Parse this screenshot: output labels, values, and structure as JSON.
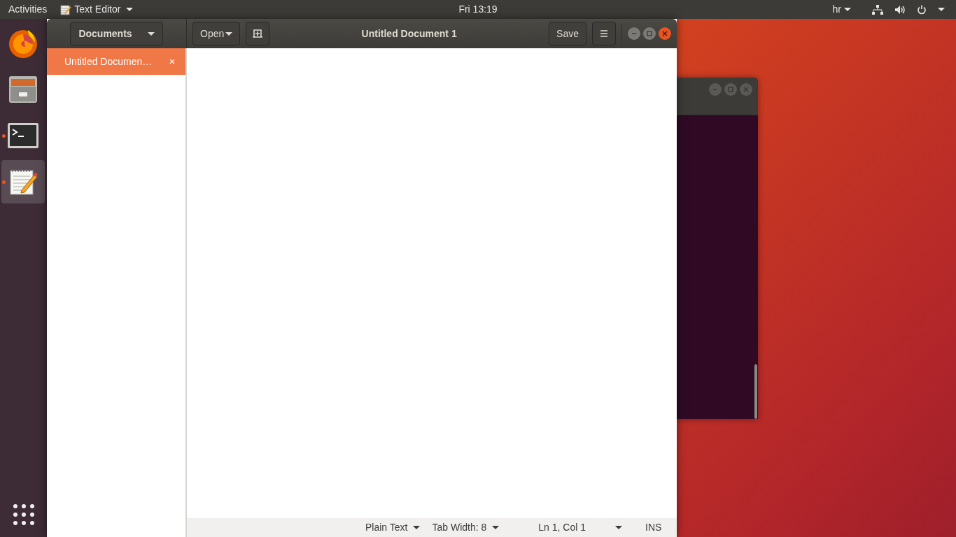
{
  "top_bar": {
    "activities": "Activities",
    "app_menu": "Text Editor",
    "clock": "Fri 13:19",
    "keyboard_layout": "hr"
  },
  "dock": [
    {
      "kind": "browser",
      "running": false,
      "selected": false
    },
    {
      "kind": "files",
      "running": false,
      "selected": false
    },
    {
      "kind": "terminal",
      "running": true,
      "selected": false
    },
    {
      "kind": "editor",
      "running": true,
      "selected": true
    }
  ],
  "editor_window": {
    "title": "Untitled Document 1",
    "documents_button": "Documents",
    "open_button": "Open",
    "save_button": "Save",
    "documents": [
      {
        "label": "Untitled Documen…",
        "selected": true
      }
    ],
    "status_bar": {
      "language": "Plain Text",
      "tab_width": "Tab Width: 8",
      "position": "Ln 1, Col 1",
      "mode": "INS"
    }
  }
}
